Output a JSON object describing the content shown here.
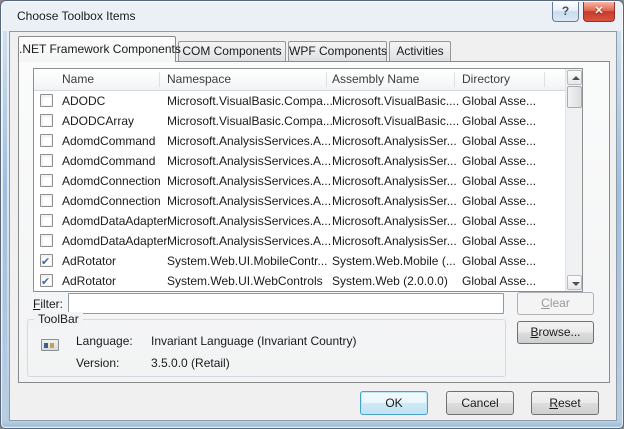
{
  "window": {
    "title": "Choose Toolbox Items",
    "help_glyph": "?",
    "close_glyph": "✕"
  },
  "tabs": [
    {
      "label": ".NET Framework Components",
      "active": true
    },
    {
      "label": "COM Components",
      "active": false
    },
    {
      "label": "WPF Components",
      "active": false
    },
    {
      "label": "Activities",
      "active": false
    }
  ],
  "table": {
    "columns": [
      "Name",
      "Namespace",
      "Assembly Name",
      "Directory"
    ],
    "rows": [
      {
        "checked": false,
        "name": "ADODC",
        "namespace": "Microsoft.VisualBasic.Compa...",
        "assembly": "Microsoft.VisualBasic....",
        "directory": "Global Asse..."
      },
      {
        "checked": false,
        "name": "ADODCArray",
        "namespace": "Microsoft.VisualBasic.Compa...",
        "assembly": "Microsoft.VisualBasic....",
        "directory": "Global Asse..."
      },
      {
        "checked": false,
        "name": "AdomdCommand",
        "namespace": "Microsoft.AnalysisServices.A...",
        "assembly": "Microsoft.AnalysisSer...",
        "directory": "Global Asse..."
      },
      {
        "checked": false,
        "name": "AdomdCommand",
        "namespace": "Microsoft.AnalysisServices.A...",
        "assembly": "Microsoft.AnalysisSer...",
        "directory": "Global Asse..."
      },
      {
        "checked": false,
        "name": "AdomdConnection",
        "namespace": "Microsoft.AnalysisServices.A...",
        "assembly": "Microsoft.AnalysisSer...",
        "directory": "Global Asse..."
      },
      {
        "checked": false,
        "name": "AdomdConnection",
        "namespace": "Microsoft.AnalysisServices.A...",
        "assembly": "Microsoft.AnalysisSer...",
        "directory": "Global Asse..."
      },
      {
        "checked": false,
        "name": "AdomdDataAdapter",
        "namespace": "Microsoft.AnalysisServices.A...",
        "assembly": "Microsoft.AnalysisSer...",
        "directory": "Global Asse..."
      },
      {
        "checked": false,
        "name": "AdomdDataAdapter",
        "namespace": "Microsoft.AnalysisServices.A...",
        "assembly": "Microsoft.AnalysisSer...",
        "directory": "Global Asse..."
      },
      {
        "checked": true,
        "name": "AdRotator",
        "namespace": "System.Web.UI.MobileContr...",
        "assembly": "System.Web.Mobile (...",
        "directory": "Global Asse..."
      },
      {
        "checked": true,
        "name": "AdRotator",
        "namespace": "System.Web.UI.WebControls",
        "assembly": "System.Web (2.0.0.0)",
        "directory": "Global Asse..."
      }
    ]
  },
  "filter": {
    "label_mn": "F",
    "label_rest": "ilter:",
    "value": "",
    "clear_mn": "C",
    "clear_rest": "lear"
  },
  "group": {
    "title": "ToolBar",
    "language_label": "Language:",
    "language_value": "Invariant Language (Invariant Country)",
    "version_label": "Version:",
    "version_value": "3.5.0.0 (Retail)"
  },
  "buttons": {
    "browse_mn": "B",
    "browse_rest": "rowse...",
    "ok": "OK",
    "cancel": "Cancel",
    "reset_mn": "R",
    "reset_rest": "eset"
  },
  "colors": {
    "dialog_bg": "#f0f0f0",
    "default_button_border": "#46a2c6",
    "close_button_red": "#c53b2f",
    "check_blue": "#3b6ea5",
    "disabled_text": "#9a9a9a"
  }
}
